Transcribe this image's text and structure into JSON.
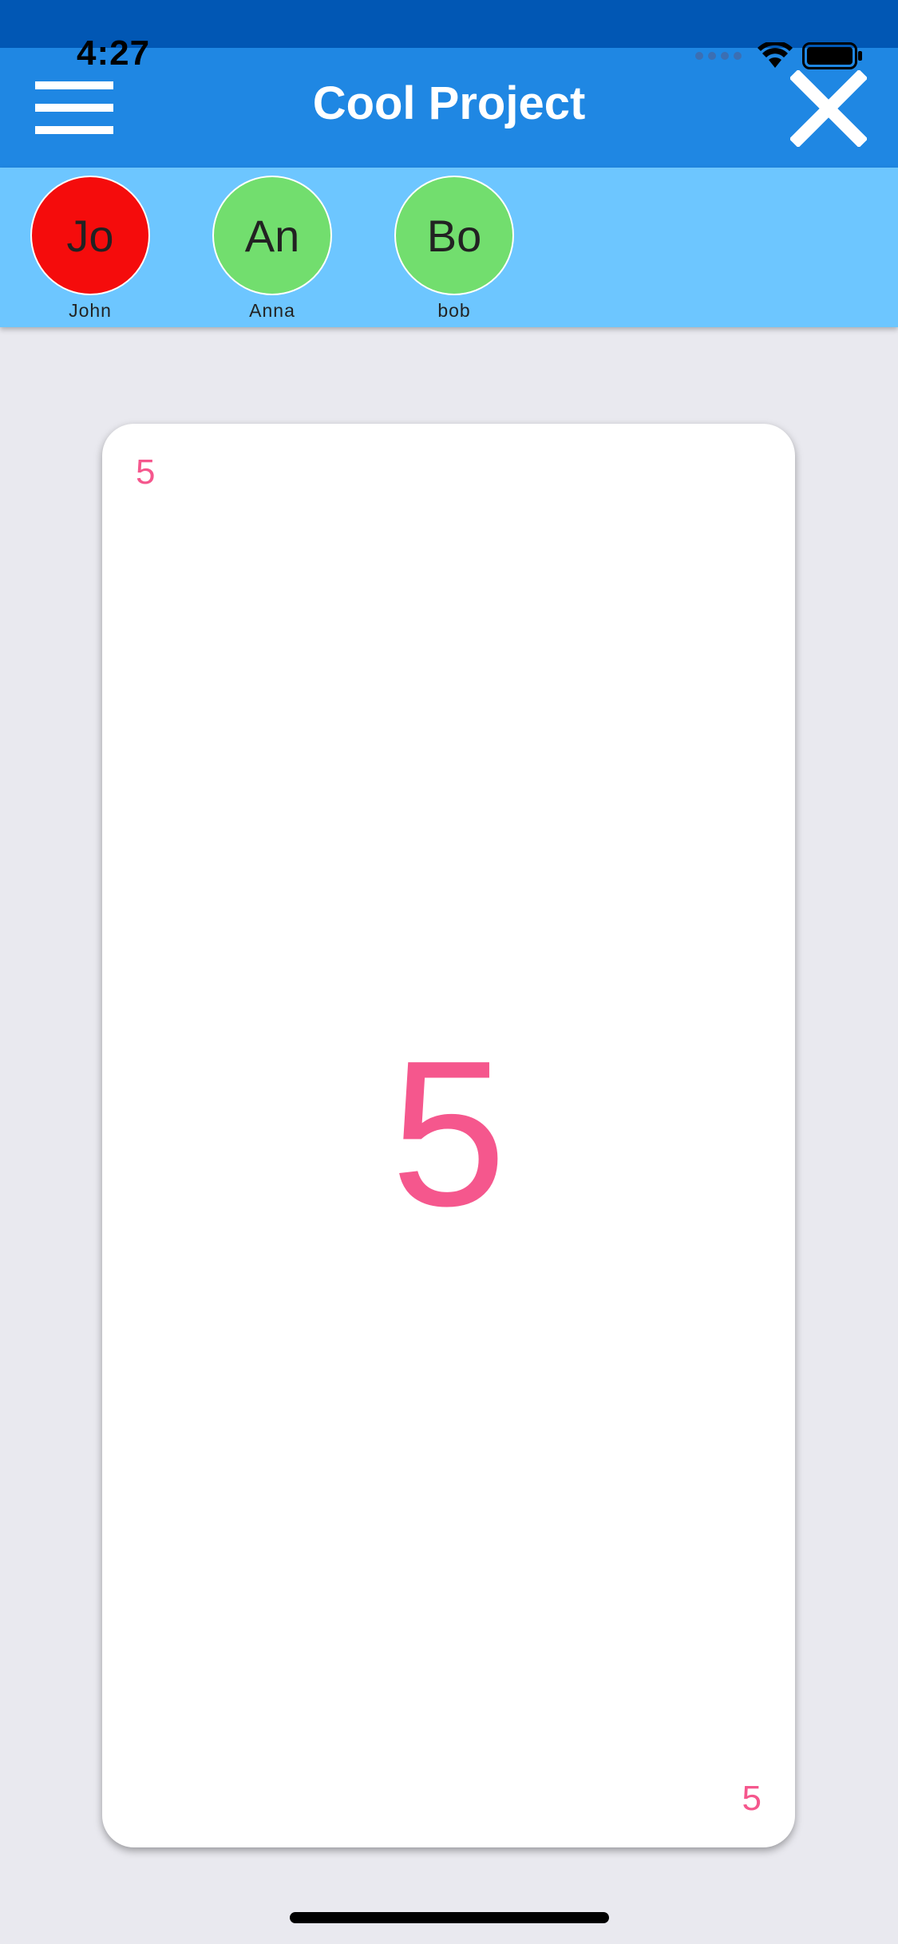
{
  "status_bar": {
    "time": "4:27",
    "icons": [
      "cellular-signal-icon",
      "wifi-icon",
      "battery-icon"
    ]
  },
  "app_bar": {
    "title": "Cool Project",
    "menu_icon": "hamburger-menu-icon",
    "close_icon": "close-icon"
  },
  "members": [
    {
      "initials": "Jo",
      "name": "John",
      "color": "#f50c0c"
    },
    {
      "initials": "An",
      "name": "Anna",
      "color": "#72de6e"
    },
    {
      "initials": "Bo",
      "name": "bob",
      "color": "#72de6e"
    }
  ],
  "card": {
    "value": "5",
    "corner_top": "5",
    "corner_bottom": "5",
    "accent_color": "#f5578d"
  },
  "colors": {
    "status_bar": "#0157b4",
    "app_bar": "#1f87e3",
    "members_bar": "#6dc6ff",
    "background": "#e9e9ef"
  }
}
